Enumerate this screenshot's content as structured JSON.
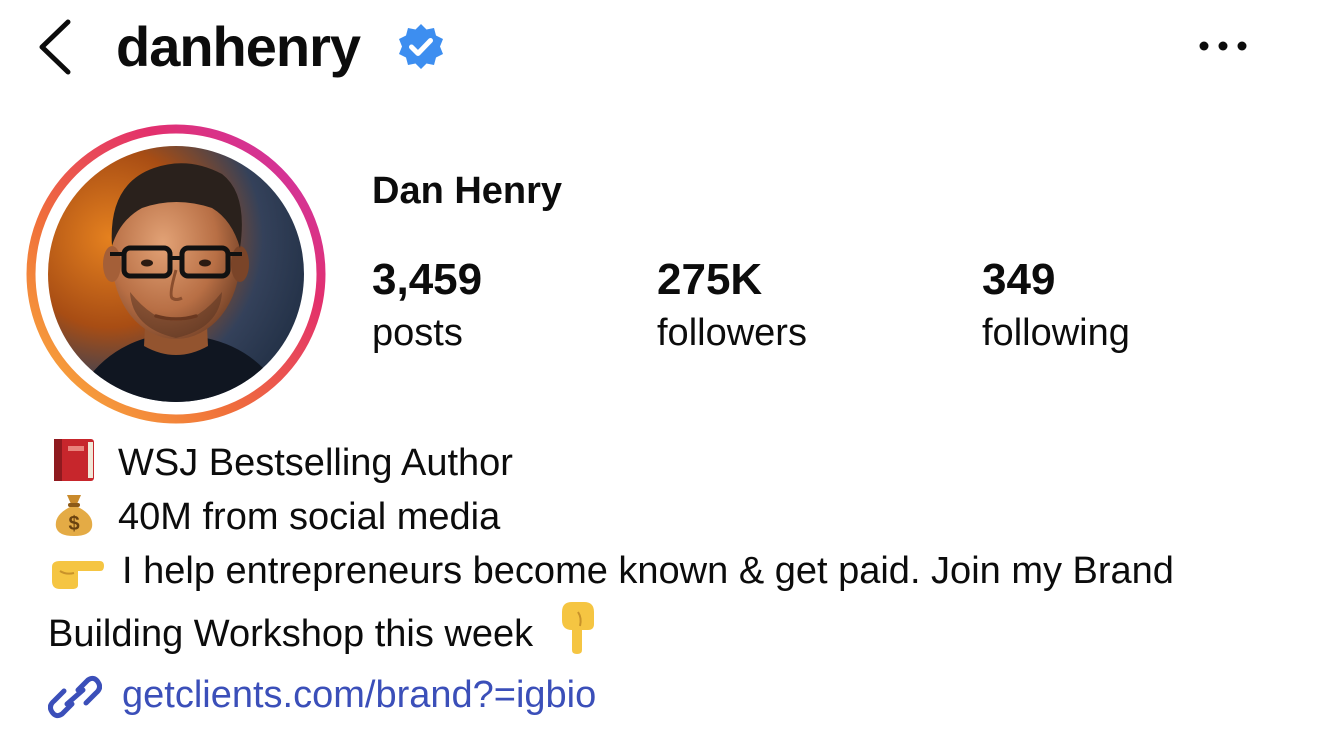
{
  "header": {
    "username": "danhenry",
    "back_icon": "chevron-left-icon",
    "verified_icon": "verified-badge-icon",
    "more_icon": "more-horizontal-icon"
  },
  "profile": {
    "display_name": "Dan Henry",
    "avatar": "profile-photo",
    "story_ring_colors": [
      "#f9b53c",
      "#f0703a",
      "#e3306c",
      "#c836b8"
    ]
  },
  "stats": [
    {
      "value": "3,459",
      "label": "posts"
    },
    {
      "value": "275K",
      "label": "followers"
    },
    {
      "value": "349",
      "label": "following"
    }
  ],
  "bio": {
    "lines": [
      {
        "icon": "book-emoji-icon",
        "text": "WSJ Bestselling Author"
      },
      {
        "icon": "money-bag-emoji-icon",
        "text": "40M from social media"
      },
      {
        "icon": "pointing-right-emoji-icon",
        "text": "I help entrepreneurs become known & get paid. Join my Brand Building Workshop this week",
        "trailing_icon": "pointing-down-emoji-icon"
      }
    ]
  },
  "link": {
    "icon": "link-icon",
    "text": "getclients.com/brand?=igbio",
    "color": "#3b4fb9"
  }
}
